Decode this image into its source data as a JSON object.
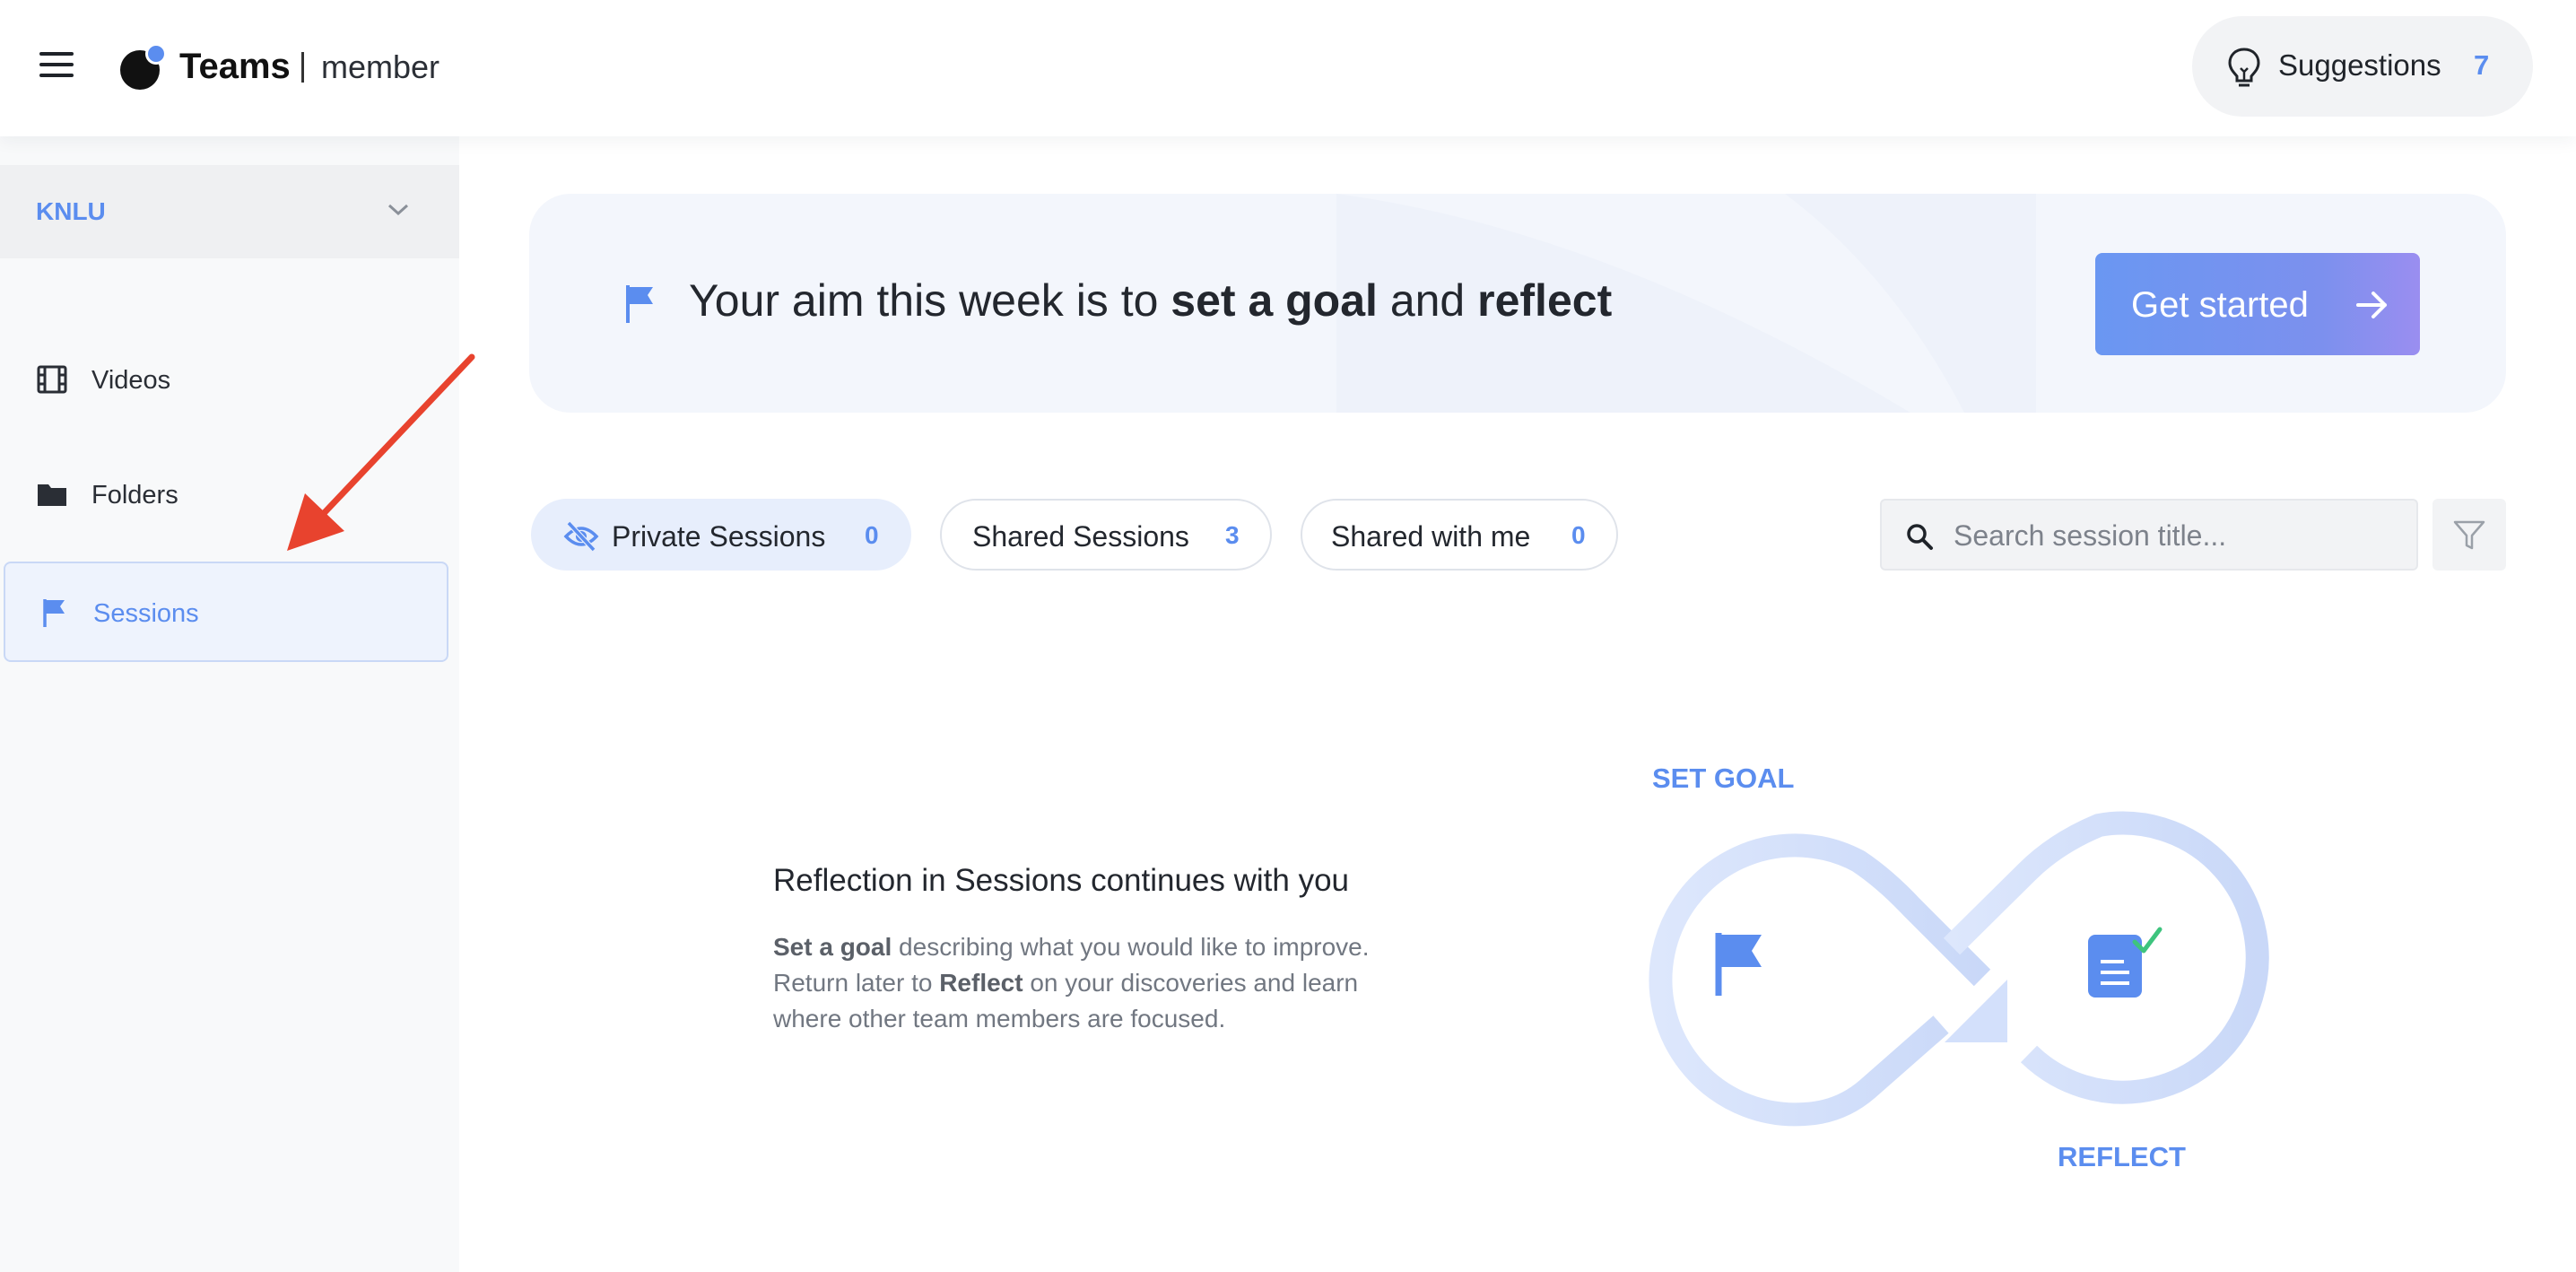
{
  "header": {
    "brand": "Teams",
    "role": "member",
    "suggestions_label": "Suggestions",
    "suggestions_count": "7"
  },
  "sidebar": {
    "org": "KNLU",
    "items": [
      {
        "label": "Videos",
        "icon": "film-icon"
      },
      {
        "label": "Folders",
        "icon": "folder-icon"
      },
      {
        "label": "Sessions",
        "icon": "flag-icon",
        "active": true
      }
    ]
  },
  "banner": {
    "aim_prefix": "Your aim this week is to ",
    "aim_goal": "set a goal",
    "aim_and": " and ",
    "aim_reflect": "reflect",
    "cta": "Get started"
  },
  "tabs": [
    {
      "label": "Private Sessions",
      "count": "0",
      "active": true
    },
    {
      "label": "Shared Sessions",
      "count": "3"
    },
    {
      "label": "Shared with me",
      "count": "0"
    }
  ],
  "search": {
    "placeholder": "Search session title..."
  },
  "empty_state": {
    "title": "Reflection in Sessions continues with you",
    "desc_goal": "Set a goal",
    "desc_part1": " describing what you would like to improve. Return later to ",
    "desc_reflect": "Reflect",
    "desc_part2": " on your discoveries and learn where other team members are focused.",
    "label_goal": "SET GOAL",
    "label_reflect": "REFLECT"
  },
  "colors": {
    "accent": "#5b8def",
    "sidebar_bg": "#f8f9fa",
    "banner_bg": "#f3f6fc",
    "annotation_arrow": "#e8432e"
  }
}
